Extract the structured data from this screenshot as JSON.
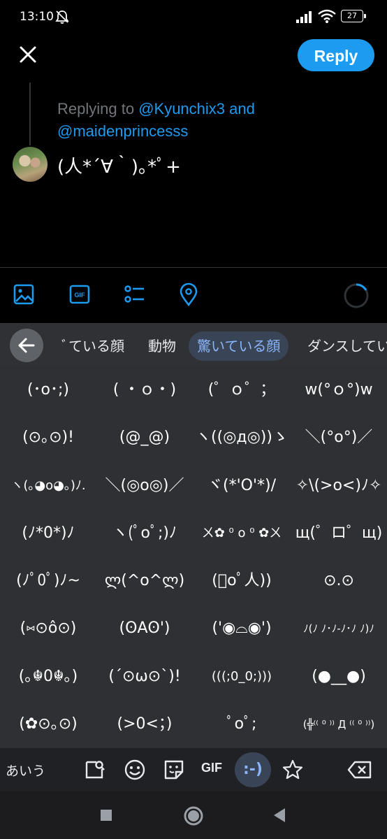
{
  "status_bar": {
    "time": "13:10",
    "battery": "27"
  },
  "compose": {
    "reply_label": "Reply",
    "replying_prefix": "Replying to ",
    "mention_1": "@Kyunchix3",
    "conjunction": " and",
    "mention_2": "@maidenprincesss",
    "tweet_text": "(人*´∀｀)｡*ﾟ+"
  },
  "keyboard": {
    "categories": [
      "ﾞている顔",
      "動物",
      "驚いている顔",
      "ダンスしてい"
    ],
    "active_category": 2,
    "kaomoji": [
      "(･o･;)",
      "( ・ｏ・)",
      "(゜ｏ゜；",
      "w(°ｏ°)w",
      "(⊙｡⊙)!",
      "(@_@)",
      "ヽ((◎д◎))ゝ",
      "＼(°o°)／",
      "ヽ(｡◕o◕｡)ﾉ.",
      "＼(◎o◎)／",
      "ヾ(*'O'*)/",
      "✧\\(>o<)ﾉ✧",
      "(ﾉ*0*)ﾉ",
      "ヽ(ﾟoﾟ;)ﾉ",
      "ㄨ✿ ⁰ o ⁰ ✿ㄨ",
      "щ(゜ロ゜щ)",
      "(ﾉﾟ0ﾟ)ﾉ~",
      "ლ(^o^ლ)",
      "(ﾟoﾟ人))",
      "⊙.⊙",
      "(⑅⊙ô⊙)",
      "(ʘAʘ')",
      "('◉⌓◉')",
      "ﾉ(ﾉ ﾉ･ﾉ-ﾉ･ﾉ ﾉ)ﾉ",
      "(｡☬0☬｡)",
      "(´⊙ω⊙`)!",
      "(((;0_0;)))",
      "(●__●)",
      "(✿⊙｡⊙)",
      "(>0<；)",
      "ﾟoﾟ;",
      "(╬⁽⁽ ⁰ ⁾⁾ Д ⁽⁽ ⁰ ⁾⁾)"
    ],
    "kana_label": "あいう",
    "gif_label": "GIF",
    "emoticon_label": ":-)"
  },
  "colors": {
    "accent": "#1d9bf0",
    "keyboard_bg": "#2f3033",
    "pill_bg": "#394457",
    "pill_text": "#8ab4f8"
  }
}
